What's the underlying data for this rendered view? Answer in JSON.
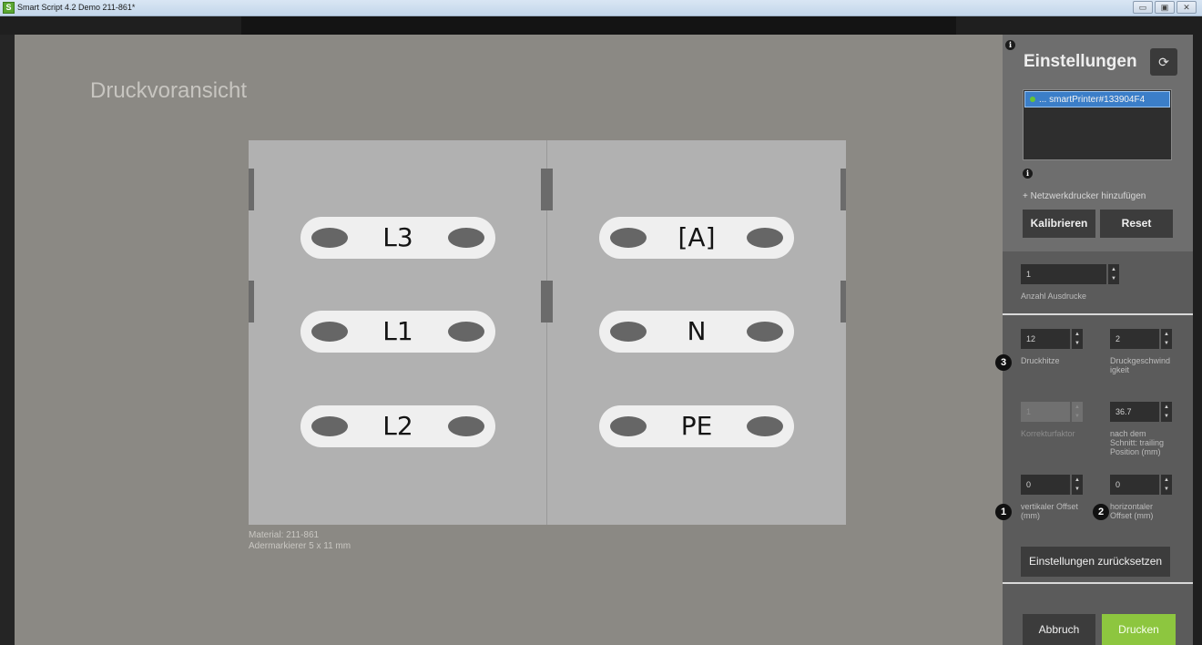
{
  "window": {
    "title": "Smart Script 4.2  Demo 211-861*",
    "app_icon": "S",
    "minimize": "▭",
    "maximize": "▣",
    "close": "✕"
  },
  "preview": {
    "title": "Druckvoransicht",
    "labels_left": [
      "L3",
      "L1",
      "L2"
    ],
    "labels_right": [
      "[A]",
      "N",
      "PE"
    ],
    "material_line1": "Material: 211-861",
    "material_line2": "Adermarkierer 5 x 11 mm"
  },
  "settings": {
    "title": "Einstellungen",
    "refresh_icon": "⟳",
    "info_icon": "i",
    "printer": "... smartPrinter#133904F4",
    "add_printer": "+ Netzwerkdrucker hinzufügen",
    "calibrate": "Kalibrieren",
    "reset": "Reset",
    "copies_value": "1",
    "copies_label": "Anzahl Ausdrucke",
    "heat_value": "12",
    "heat_label": "Druckhitze",
    "speed_value": "2",
    "speed_label_1": "Druckgeschwind",
    "speed_label_2": "igkeit",
    "correction_value": "1",
    "correction_label": "Korrekturfaktor",
    "trailing_value": "36.7",
    "trailing_label_1": "nach dem",
    "trailing_label_2": "Schnitt: trailing",
    "trailing_label_3": "Position (mm)",
    "voffset_value": "0",
    "voffset_label_1": "vertikaler Offset",
    "voffset_label_2": "(mm)",
    "hoffset_value": "0",
    "hoffset_label_1": "horizontaler",
    "hoffset_label_2": "Offset (mm)",
    "reset_settings": "Einstellungen zurücksetzen",
    "cancel": "Abbruch",
    "print": "Drucken",
    "markers": [
      "1",
      "2",
      "3"
    ],
    "spin_arrows": "▲\n▼"
  },
  "colors": {
    "accent_green": "#8dc63f",
    "selection_blue": "#3b7ec8",
    "status_green": "#67c534"
  }
}
